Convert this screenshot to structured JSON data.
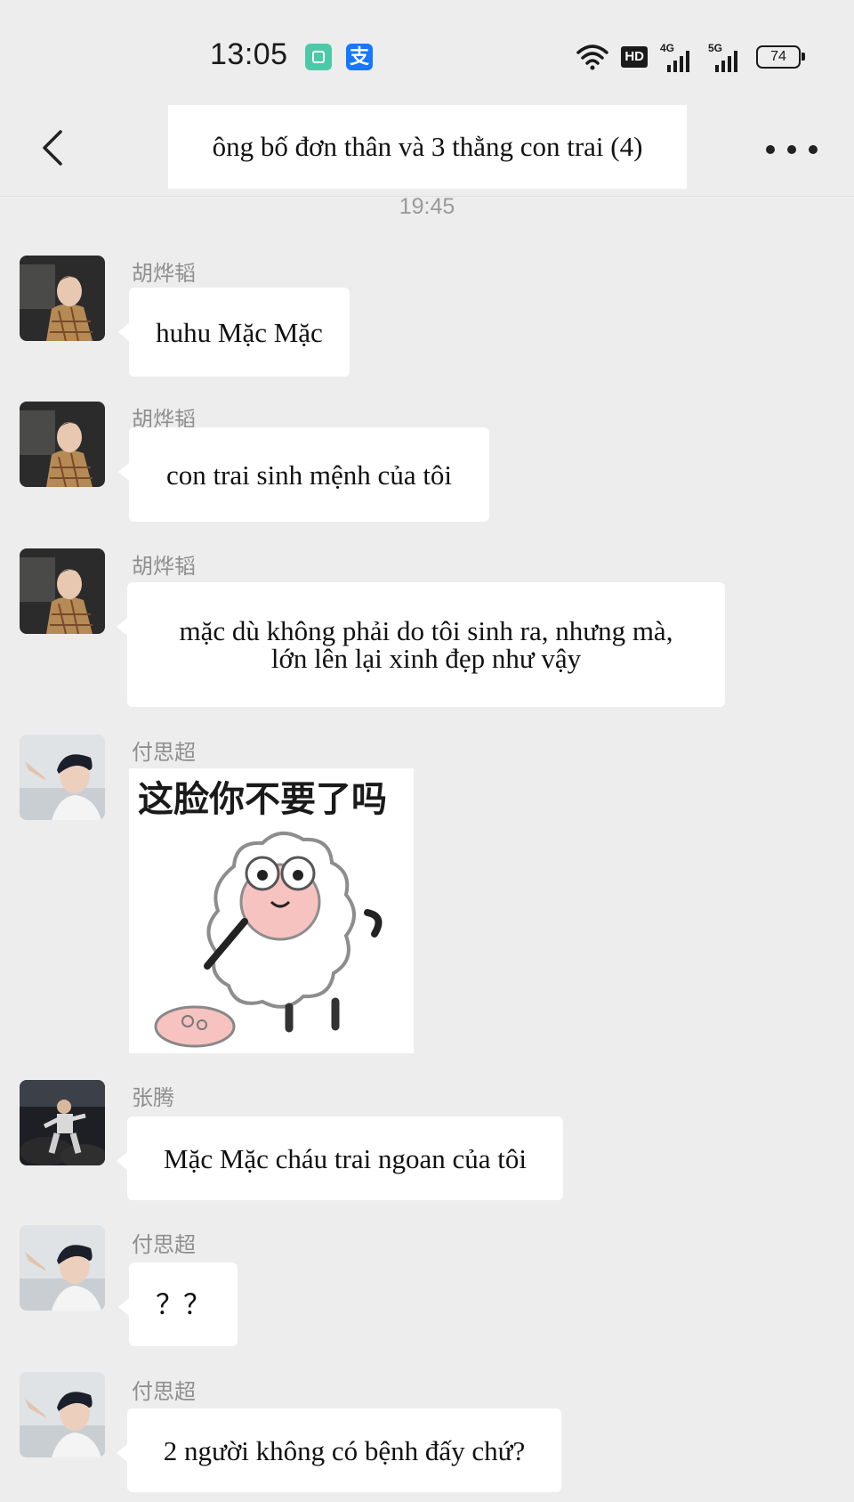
{
  "status_bar": {
    "time": "13:05",
    "app_icons": [
      "notes-app-icon",
      "alipay-icon"
    ],
    "alipay_glyph": "支",
    "hd_label": "HD",
    "network_1": "4G",
    "network_2": "5G",
    "battery": "74"
  },
  "header": {
    "title": "ông bố đơn thân và 3 thằng con trai (4)"
  },
  "chat": {
    "timestamp": "19:45",
    "messages": [
      {
        "sender": "胡烨韬",
        "text": "huhu Mặc Mặc"
      },
      {
        "sender": "胡烨韬",
        "text": "con trai sinh mệnh của tôi"
      },
      {
        "sender": "胡烨韬",
        "text_line1": "mặc dù không phải do tôi sinh ra, nhưng mà,",
        "text_line2": "lớn lên lại xinh đẹp như vậy"
      },
      {
        "sender": "付思超",
        "sticker_caption": "这脸你不要了吗"
      },
      {
        "sender": "张腾",
        "text": "Mặc Mặc cháu trai ngoan của tôi"
      },
      {
        "sender": "付思超",
        "text": "？？"
      },
      {
        "sender": "付思超",
        "text": "2 người không có bệnh đấy chứ?"
      }
    ]
  },
  "colors": {
    "background": "#ededed",
    "bubble": "#ffffff",
    "sender_name": "#8f8f8f"
  }
}
